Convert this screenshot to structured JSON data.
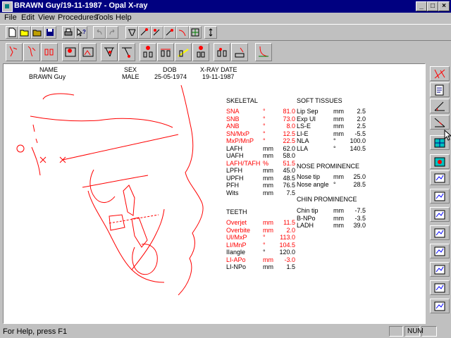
{
  "window": {
    "title": "BRAWN Guy/19-11-1987 - Opal X-ray"
  },
  "menu": [
    "File",
    "Edit",
    "View",
    "Procedures",
    "Tools",
    "Help"
  ],
  "patient": {
    "headers": {
      "name": "NAME",
      "sex": "SEX",
      "dob": "DOB",
      "xray": "X-RAY DATE"
    },
    "name": "BRAWN Guy",
    "sex": "MALE",
    "dob": "25-05-1974",
    "xray": "19-11-1987"
  },
  "skeletal": {
    "heading": "SKELETAL",
    "rows": [
      {
        "label": "SNA",
        "unit": "°",
        "value": "81.0",
        "color": "#ff0000"
      },
      {
        "label": "SNB",
        "unit": "°",
        "value": "73.0",
        "color": "#ff0000"
      },
      {
        "label": "ANB",
        "unit": "°",
        "value": "8.0",
        "color": "#ff0000"
      },
      {
        "label": "SN/MxP",
        "unit": "°",
        "value": "12.5",
        "color": "#ff0000"
      },
      {
        "label": "MxP/MnP",
        "unit": "°",
        "value": "22.5",
        "color": "#ff0000"
      },
      {
        "label": "LAFH",
        "unit": "mm",
        "value": "62.0",
        "color": "#000000"
      },
      {
        "label": "UAFH",
        "unit": "mm",
        "value": "58.0",
        "color": "#000000"
      },
      {
        "label": "LAFH/TAFH",
        "unit": "%",
        "value": "51.5",
        "color": "#ff0000"
      },
      {
        "label": "LPFH",
        "unit": "mm",
        "value": "45.0",
        "color": "#000000"
      },
      {
        "label": "UPFH",
        "unit": "mm",
        "value": "48.5",
        "color": "#000000"
      },
      {
        "label": "PFH",
        "unit": "mm",
        "value": "76.5",
        "color": "#000000"
      },
      {
        "label": "Wits",
        "unit": "mm",
        "value": "7.5",
        "color": "#000000"
      }
    ]
  },
  "teeth": {
    "heading": "TEETH",
    "rows": [
      {
        "label": "Overjet",
        "unit": "mm",
        "value": "11.5",
        "color": "#ff0000"
      },
      {
        "label": "Overbite",
        "unit": "mm",
        "value": "2.0",
        "color": "#ff0000"
      },
      {
        "label": "UI/MxP",
        "unit": "°",
        "value": "113.0",
        "color": "#ff0000"
      },
      {
        "label": "LI/MnP",
        "unit": "°",
        "value": "104.5",
        "color": "#ff0000"
      },
      {
        "label": "IIangle",
        "unit": "°",
        "value": "120.0",
        "color": "#000000"
      },
      {
        "label": "LI-APo",
        "unit": "mm",
        "value": "-3.0",
        "color": "#ff0000"
      },
      {
        "label": "LI-NPo",
        "unit": "mm",
        "value": "1.5",
        "color": "#000000"
      }
    ]
  },
  "soft": {
    "heading": "SOFT TISSUES",
    "rows": [
      {
        "label": "Lip Sep",
        "unit": "mm",
        "value": "2.5"
      },
      {
        "label": "Exp UI",
        "unit": "mm",
        "value": "2.0"
      },
      {
        "label": "LS-E",
        "unit": "mm",
        "value": "2.5"
      },
      {
        "label": "LI-E",
        "unit": "mm",
        "value": "-5.5"
      },
      {
        "label": "NLA",
        "unit": "°",
        "value": "100.0"
      },
      {
        "label": "LLA",
        "unit": "°",
        "value": "140.5"
      }
    ]
  },
  "nose": {
    "heading": "NOSE PROMINENCE",
    "rows": [
      {
        "label": "Nose tip",
        "unit": "mm",
        "value": "25.0"
      },
      {
        "label": "Nose angle",
        "unit": "°",
        "value": "28.5"
      }
    ]
  },
  "chin": {
    "heading": "CHIN PROMINENCE",
    "rows": [
      {
        "label": "Chin tip",
        "unit": "mm",
        "value": "-7.5"
      },
      {
        "label": "B-NPo",
        "unit": "mm",
        "value": "-3.5"
      },
      {
        "label": "LADH",
        "unit": "mm",
        "value": "39.0"
      }
    ]
  },
  "status": {
    "message": "For Help, press F1",
    "num": "NUM"
  },
  "colors": {
    "trace": "#ff0000",
    "titlebar": "#000080",
    "face": "#c0c0c0"
  }
}
